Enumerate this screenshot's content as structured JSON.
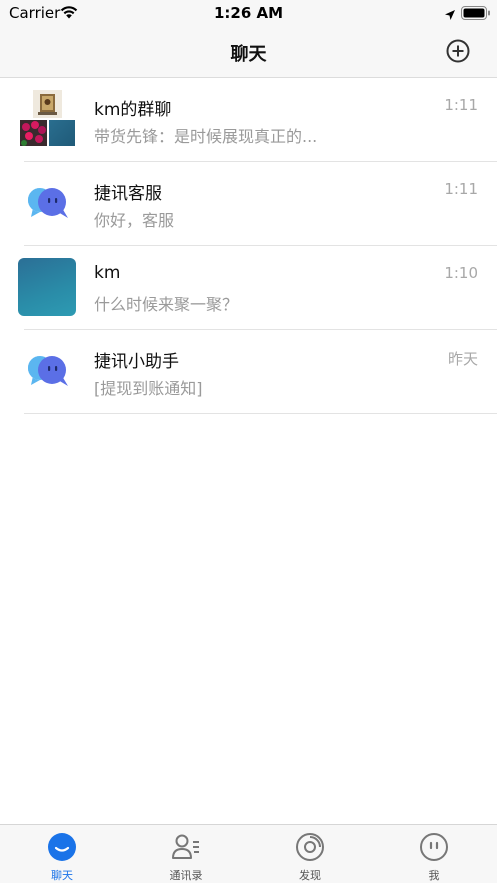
{
  "status_bar": {
    "carrier": "Carrier",
    "time": "1:26 AM"
  },
  "nav": {
    "title": "聊天",
    "add_icon": "plus-circle-icon"
  },
  "chats": [
    {
      "name": "km的群聊",
      "preview": "带货先锋：是时候展现真正的...",
      "time": "1:11",
      "avatar": "group-collage"
    },
    {
      "name": "捷讯客服",
      "preview": "你好，客服",
      "time": "1:11",
      "avatar": "chat-bubbles-logo"
    },
    {
      "name": "km",
      "preview": "什么时候来聚一聚？",
      "time": "1:10",
      "avatar": "teal-photo"
    },
    {
      "name": "捷讯小助手",
      "preview": "[提现到账通知]",
      "time": "昨天",
      "avatar": "chat-bubbles-logo"
    }
  ],
  "tabs": [
    {
      "label": "聊天",
      "icon": "chat-icon",
      "active": true
    },
    {
      "label": "通讯录",
      "icon": "contacts-icon",
      "active": false
    },
    {
      "label": "发现",
      "icon": "discover-icon",
      "active": false
    },
    {
      "label": "我",
      "icon": "profile-icon",
      "active": false
    }
  ],
  "colors": {
    "accent": "#1a73e8",
    "background": "#ffffff",
    "bar_background": "#f7f7f7",
    "secondary_text": "#9a9a9a"
  }
}
